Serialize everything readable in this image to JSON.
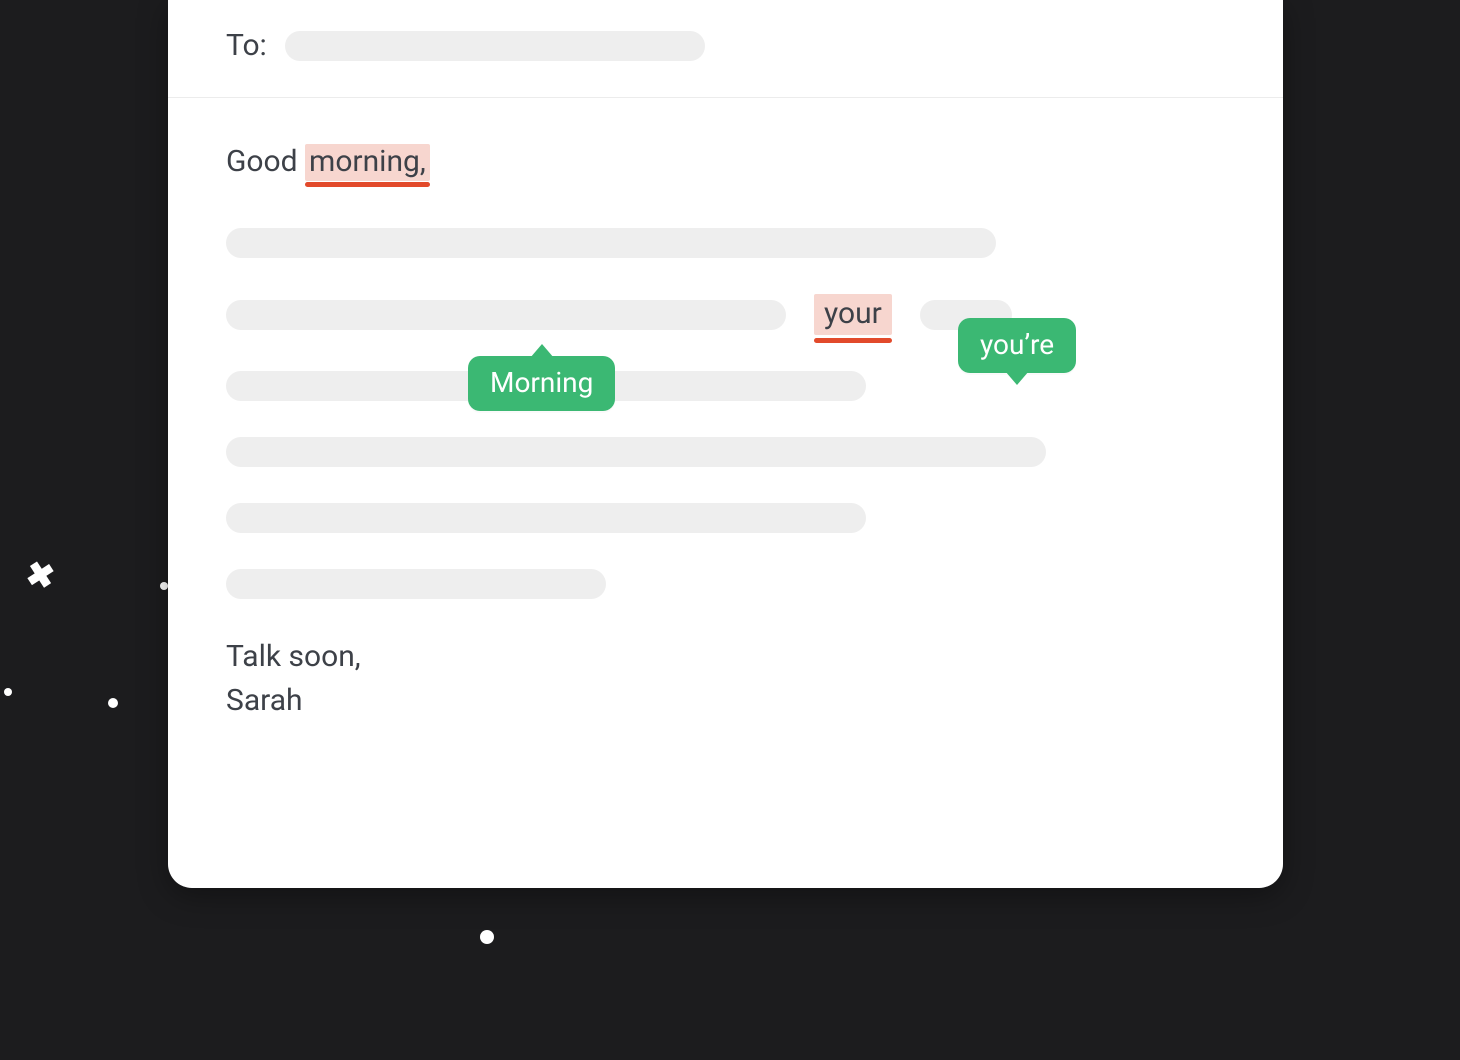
{
  "compose": {
    "to_label": "To:",
    "greeting_prefix": "Good ",
    "greeting_error": "morning,",
    "suggestion_morning": "Morning",
    "error_your": "your",
    "suggestion_youre": "you’re",
    "signoff_line1": "Talk soon,",
    "signoff_line2": "Sarah"
  },
  "colors": {
    "highlight_bg": "#f7d6cf",
    "underline": "#e24a2b",
    "suggestion_bg": "#3bb873"
  }
}
